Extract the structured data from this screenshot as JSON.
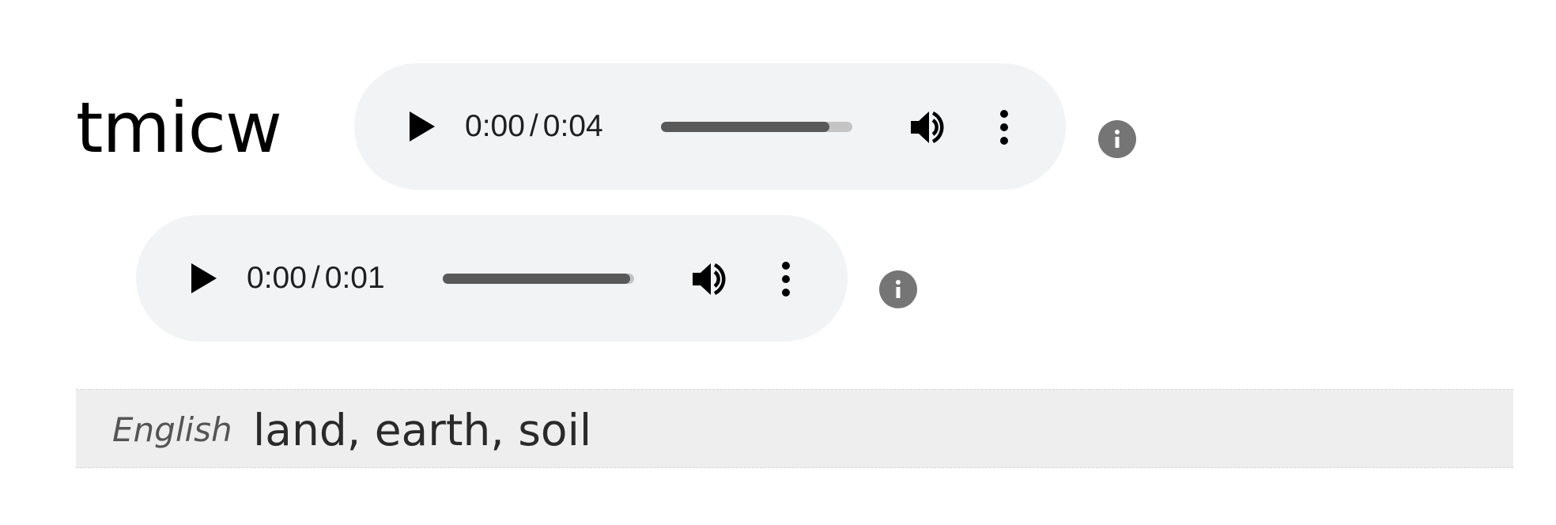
{
  "entry": {
    "word": "tmicw"
  },
  "audio_players": [
    {
      "current_time": "0:00",
      "separator": "/",
      "duration": "0:04",
      "buffered_fraction": 0.88,
      "play_icon": "play-icon",
      "volume_icon": "volume-icon",
      "menu_icon": "more-vert-icon"
    },
    {
      "current_time": "0:00",
      "separator": "/",
      "duration": "0:01",
      "buffered_fraction": 0.98,
      "play_icon": "play-icon",
      "volume_icon": "volume-icon",
      "menu_icon": "more-vert-icon"
    }
  ],
  "info_icon": "info-icon",
  "translation": {
    "language": "English",
    "text": "land, earth, soil"
  },
  "colors": {
    "player_background": "#f1f3f4",
    "progress_track": "#c4c4c4",
    "progress_buffered": "#595959",
    "info_badge": "#757575",
    "translation_background": "#eeeeee"
  }
}
